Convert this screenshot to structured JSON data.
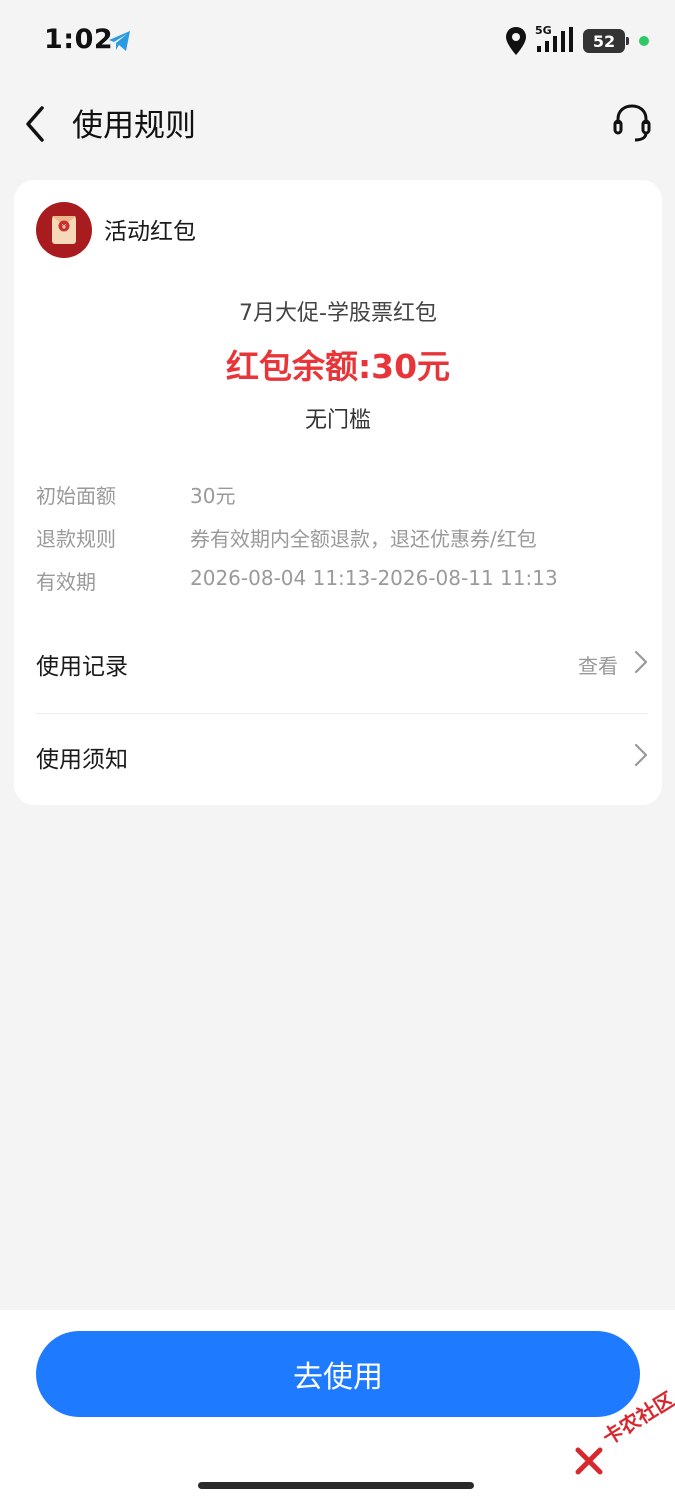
{
  "status": {
    "time": "1:02",
    "network": "5G",
    "battery": "52"
  },
  "header": {
    "title": "使用规则"
  },
  "card": {
    "type_label": "活动红包",
    "campaign_name": "7月大促-学股票红包",
    "balance_text": "红包余额:30元",
    "threshold_text": "无门槛",
    "details": [
      {
        "label": "初始面额",
        "value": "30元"
      },
      {
        "label": "退款规则",
        "value": "券有效期内全额退款，退还优惠券/红包"
      },
      {
        "label": "有效期",
        "value": "2026-08-04 11:13-2026-08-11 11:13"
      }
    ],
    "usage_record": {
      "label": "使用记录",
      "action": "查看"
    },
    "usage_notice": {
      "label": "使用须知"
    }
  },
  "footer": {
    "button_label": "去使用"
  },
  "watermark": {
    "text": "卡农社区"
  },
  "colors": {
    "accent": "#1e7bff",
    "balance": "#e8353a",
    "icon_red": "#a81b1e"
  }
}
